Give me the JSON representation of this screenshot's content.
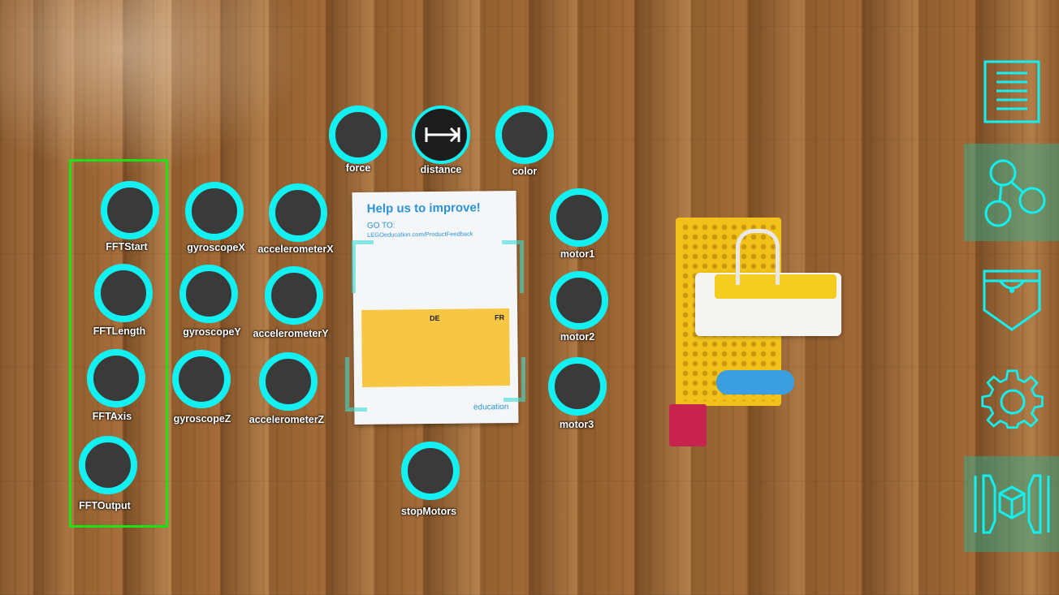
{
  "colors": {
    "accent": "#13f0f2",
    "selection_box": "#19e313",
    "node_fill": "#3a3a3a"
  },
  "nodes": {
    "force": "force",
    "distance": "distance",
    "color": "color",
    "fft_start": "FFTStart",
    "fft_length": "FFTLength",
    "fft_axis": "FFTAxis",
    "fft_output": "FFTOutput",
    "gyroscope_x": "gyroscopeX",
    "gyroscope_y": "gyroscopeY",
    "gyroscope_z": "gyroscopeZ",
    "accelerometer_x": "accelerometerX",
    "accelerometer_y": "accelerometerY",
    "accelerometer_z": "accelerometerZ",
    "motor1": "motor1",
    "motor2": "motor2",
    "motor3": "motor3",
    "stop_motors": "stopMotors"
  },
  "pamphlet": {
    "title": "Help us to improve!",
    "goto": "GO TO:",
    "url": "LEGOeducation.com/ProductFeedback",
    "lang_de": "DE",
    "lang_fr": "FR",
    "brand": "education"
  },
  "toolbar": {
    "items": [
      {
        "icon": "document-lines-icon"
      },
      {
        "icon": "node-graph-icon",
        "active": true
      },
      {
        "icon": "pocket-icon"
      },
      {
        "icon": "gear-icon"
      },
      {
        "icon": "ar-cube-icon",
        "active": true
      }
    ]
  }
}
